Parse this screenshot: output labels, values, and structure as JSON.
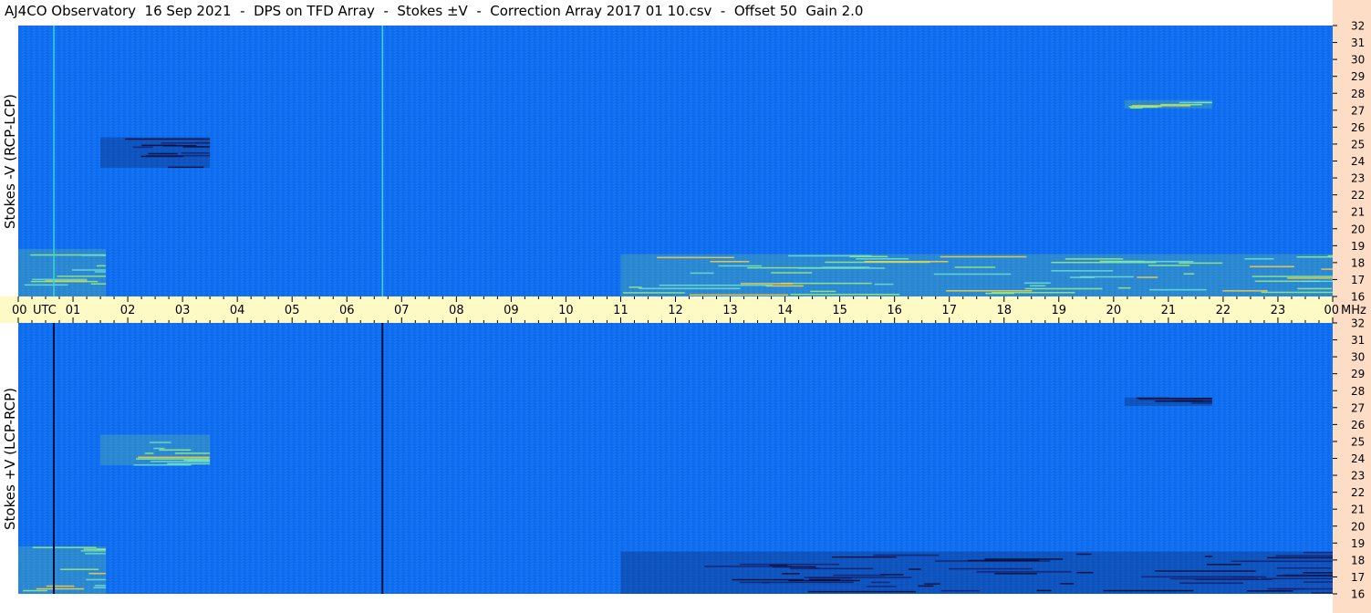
{
  "title": "AJ4CO Observatory  16 Sep 2021  -  DPS on TFD Array  -  Stokes ±V  -  Correction Array 2017 01 10.csv  -  Offset 50  Gain 2.0",
  "colors": {
    "background": "#0f6ef0",
    "axis_band": "#fefac6",
    "right_band": "#fdddc6",
    "bright_emission": "#8fe86a",
    "dark_emission": "#0a1140"
  },
  "chart_data": [
    {
      "type": "heatmap",
      "panel": "top",
      "ylabel": "Stokes -V  (RCP-LCP)",
      "y_unit": "MHz",
      "ylim": [
        16,
        32
      ],
      "y_ticks": [
        "32",
        "31",
        "30",
        "29",
        "28",
        "27",
        "26",
        "25",
        "24",
        "23",
        "22",
        "21",
        "20",
        "19",
        "18",
        "17",
        "16"
      ],
      "x_unit": "UTC",
      "xlim": [
        0,
        24
      ],
      "vertical_lines_utc": [
        0.65,
        6.65
      ],
      "emission_features": [
        {
          "x_start": 11.0,
          "x_end": 24.0,
          "y_low": 16.0,
          "y_high": 18.5,
          "polarity": "bright"
        },
        {
          "x_start": 20.2,
          "x_end": 21.8,
          "y_low": 27.1,
          "y_high": 27.6,
          "polarity": "bright"
        },
        {
          "x_start": 0.0,
          "x_end": 1.6,
          "y_low": 16.0,
          "y_high": 18.8,
          "polarity": "bright"
        },
        {
          "x_start": 1.5,
          "x_end": 3.5,
          "y_low": 23.6,
          "y_high": 25.4,
          "polarity": "dark"
        }
      ]
    },
    {
      "type": "heatmap",
      "panel": "bottom",
      "ylabel": "Stokes +V  (LCP-RCP)",
      "y_unit": "MHz",
      "ylim": [
        16,
        32
      ],
      "y_ticks": [
        "32",
        "31",
        "30",
        "29",
        "28",
        "27",
        "26",
        "25",
        "24",
        "23",
        "22",
        "21",
        "20",
        "19",
        "18",
        "17",
        "16"
      ],
      "x_unit": "UTC",
      "xlim": [
        0,
        24
      ],
      "vertical_lines_utc": [
        0.65,
        6.65
      ],
      "emission_features": [
        {
          "x_start": 11.0,
          "x_end": 24.0,
          "y_low": 16.0,
          "y_high": 18.5,
          "polarity": "dark"
        },
        {
          "x_start": 20.2,
          "x_end": 21.8,
          "y_low": 27.1,
          "y_high": 27.6,
          "polarity": "dark"
        },
        {
          "x_start": 0.0,
          "x_end": 1.6,
          "y_low": 16.0,
          "y_high": 18.8,
          "polarity": "bright"
        },
        {
          "x_start": 1.5,
          "x_end": 3.5,
          "y_low": 23.6,
          "y_high": 25.4,
          "polarity": "bright"
        }
      ]
    }
  ],
  "x_axis": {
    "tick_labels": [
      "00",
      "01",
      "02",
      "03",
      "04",
      "05",
      "06",
      "07",
      "08",
      "09",
      "10",
      "11",
      "12",
      "13",
      "14",
      "15",
      "16",
      "17",
      "18",
      "19",
      "20",
      "21",
      "22",
      "23",
      "00"
    ],
    "utc_label": "UTC",
    "mhz_label": "MHz"
  }
}
